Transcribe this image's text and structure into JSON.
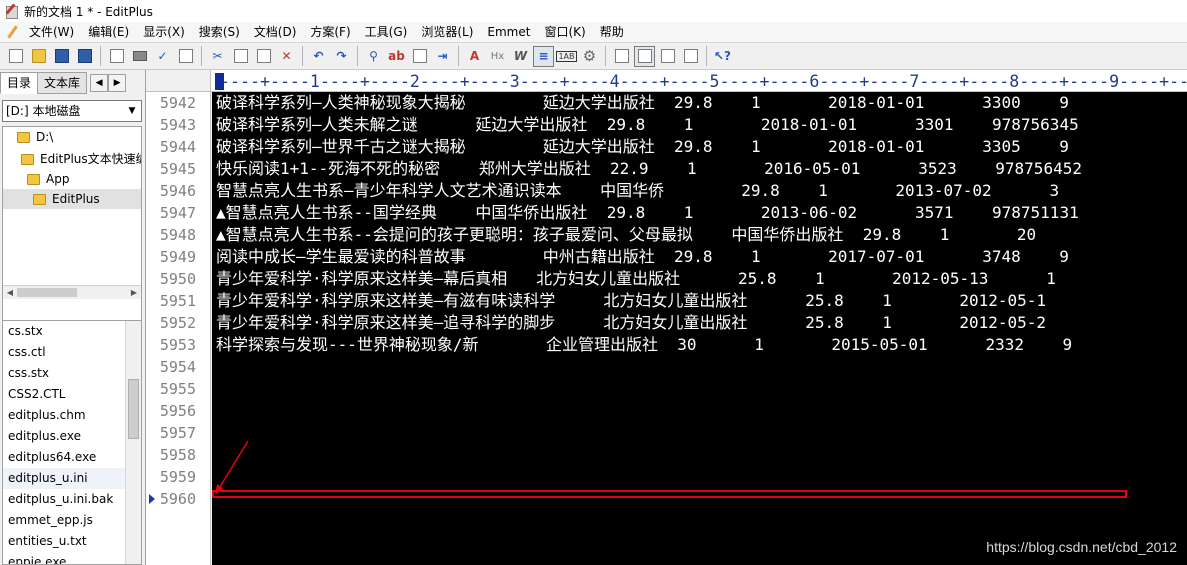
{
  "window": {
    "title": "新的文档 1 * - EditPlus"
  },
  "menu": [
    "文件(W)",
    "编辑(E)",
    "显示(X)",
    "搜索(S)",
    "文档(D)",
    "方案(F)",
    "工具(G)",
    "浏览器(L)",
    "Emmet",
    "窗口(K)",
    "帮助"
  ],
  "sidebar": {
    "tabs": [
      "目录",
      "文本库"
    ],
    "drive": "[D:] 本地磁盘",
    "tree": [
      "D:\\",
      "EditPlus文本快速编辑",
      "App",
      "EditPlus"
    ],
    "files": [
      "cs.stx",
      "css.ctl",
      "css.stx",
      "CSS2.CTL",
      "editplus.chm",
      "editplus.exe",
      "editplus64.exe",
      "editplus_u.ini",
      "editplus_u.ini.bak",
      "emmet_epp.js",
      "entities_u.txt",
      "eppie.exe"
    ]
  },
  "ruler": "----+----1----+----2----+----3----+----4----+----5----+----6----+----7----+----8----+----9----+----",
  "editor": {
    "line_numbers": [
      "5942",
      "5943",
      "5944",
      "5945",
      "5946",
      "5947",
      "5948",
      "5949",
      "5950",
      "5951",
      "5952",
      "5953",
      "5954",
      "5955",
      "5956",
      "5957",
      "5958",
      "5959",
      "5960"
    ],
    "lines": [
      "破译科学系列—人类神秘现象大揭秘        延边大学出版社  29.8    1       2018-01-01      3300    9",
      "破译科学系列—人类未解之谜      延边大学出版社  29.8    1       2018-01-01      3301    978756345",
      "破译科学系列—世界千古之谜大揭秘        延边大学出版社  29.8    1       2018-01-01      3305    9",
      "快乐阅读1+1--死海不死的秘密    郑州大学出版社  22.9    1       2016-05-01      3523    978756452",
      "智慧点亮人生书系—青少年科学人文艺术通识读本    中国华侨        29.8    1       2013-07-02      3",
      "▲智慧点亮人生书系--国学经典    中国华侨出版社  29.8    1       2013-06-02      3571    978751131",
      "▲智慧点亮人生书系--会提问的孩子更聪明：孩子最爱问、父母最拟    中国华侨出版社  29.8    1       20",
      "阅读中成长—学生最爱读的科普故事        中州古籍出版社  29.8    1       2017-07-01      3748    9",
      "青少年爱科学·科学原来这样美—幕后真相   北方妇女儿童出版社      25.8    1       2012-05-13      1",
      "青少年爱科学·科学原来这样美—有滋有味读科学     北方妇女儿童出版社      25.8    1       2012-05-1",
      "青少年爱科学·科学原来这样美—追寻科学的脚步     北方妇女儿童出版社      25.8    1       2012-05-2",
      "科学探索与发现---世界神秘现象/新       企业管理出版社  30      1       2015-05-01      2332    9",
      "",
      "",
      "",
      "",
      "",
      "",
      ""
    ],
    "watermark": "https://blog.csdn.net/cbd_2012"
  }
}
